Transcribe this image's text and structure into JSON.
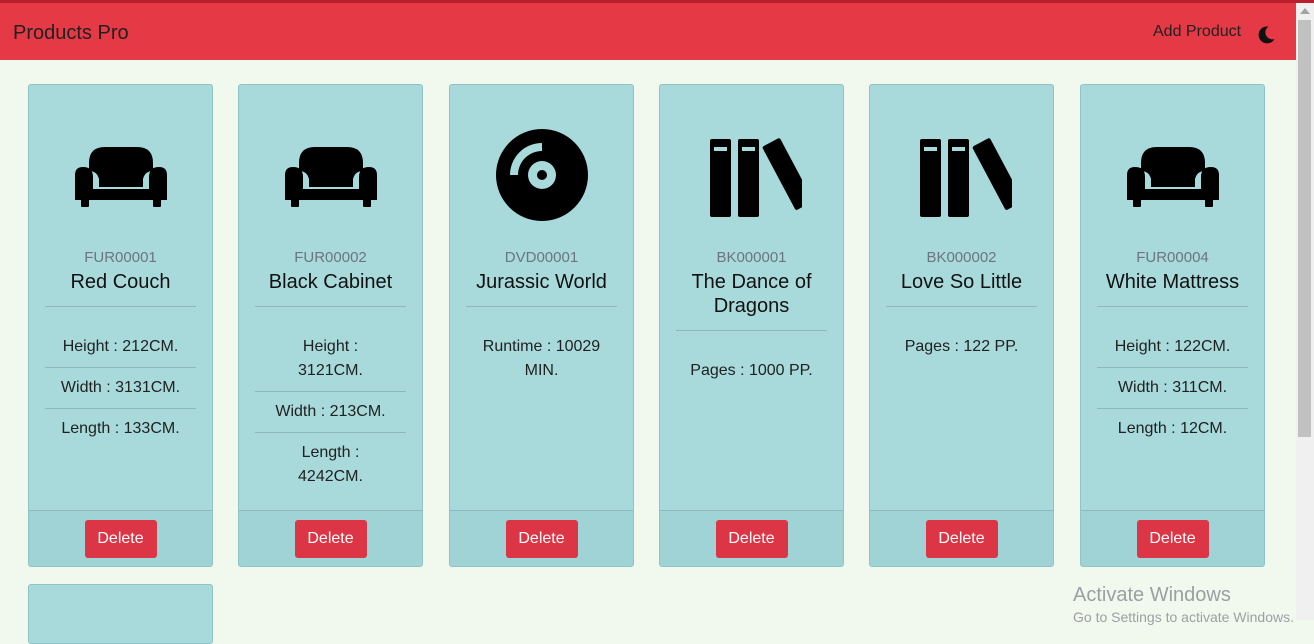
{
  "app": {
    "title": "Products Pro"
  },
  "nav": {
    "add_product": "Add Product",
    "theme_icon": "moon-icon"
  },
  "colors": {
    "navbar": "#e63946",
    "card": "#a8dadc",
    "delete": "#dc3545",
    "background": "#f1f9ee"
  },
  "products": [
    {
      "sku": "FUR00001",
      "name": "Red Couch",
      "icon": "couch-icon",
      "props": [
        "Height : 212CM.",
        "Width : 3131CM.",
        "Length : 133CM."
      ],
      "delete_label": "Delete"
    },
    {
      "sku": "FUR00002",
      "name": "Black Cabinet",
      "icon": "couch-icon",
      "props": [
        "Height : 3121CM.",
        "Width : 213CM.",
        "Length : 4242CM."
      ],
      "delete_label": "Delete"
    },
    {
      "sku": "DVD00001",
      "name": "Jurassic World",
      "icon": "compact-disc-icon",
      "props": [
        "Runtime : 10029 MIN."
      ],
      "delete_label": "Delete"
    },
    {
      "sku": "BK000001",
      "name": "The Dance of Dragons",
      "icon": "books-icon",
      "props": [
        "Pages : 1000 PP."
      ],
      "delete_label": "Delete"
    },
    {
      "sku": "BK000002",
      "name": "Love So Little",
      "icon": "books-icon",
      "props": [
        "Pages : 122 PP."
      ],
      "delete_label": "Delete"
    },
    {
      "sku": "FUR00004",
      "name": "White Mattress",
      "icon": "couch-icon",
      "props": [
        "Height : 122CM.",
        "Width : 311CM.",
        "Length : 12CM."
      ],
      "delete_label": "Delete"
    }
  ],
  "watermark": {
    "line1": "Activate Windows",
    "line2": "Go to Settings to activate Windows."
  }
}
